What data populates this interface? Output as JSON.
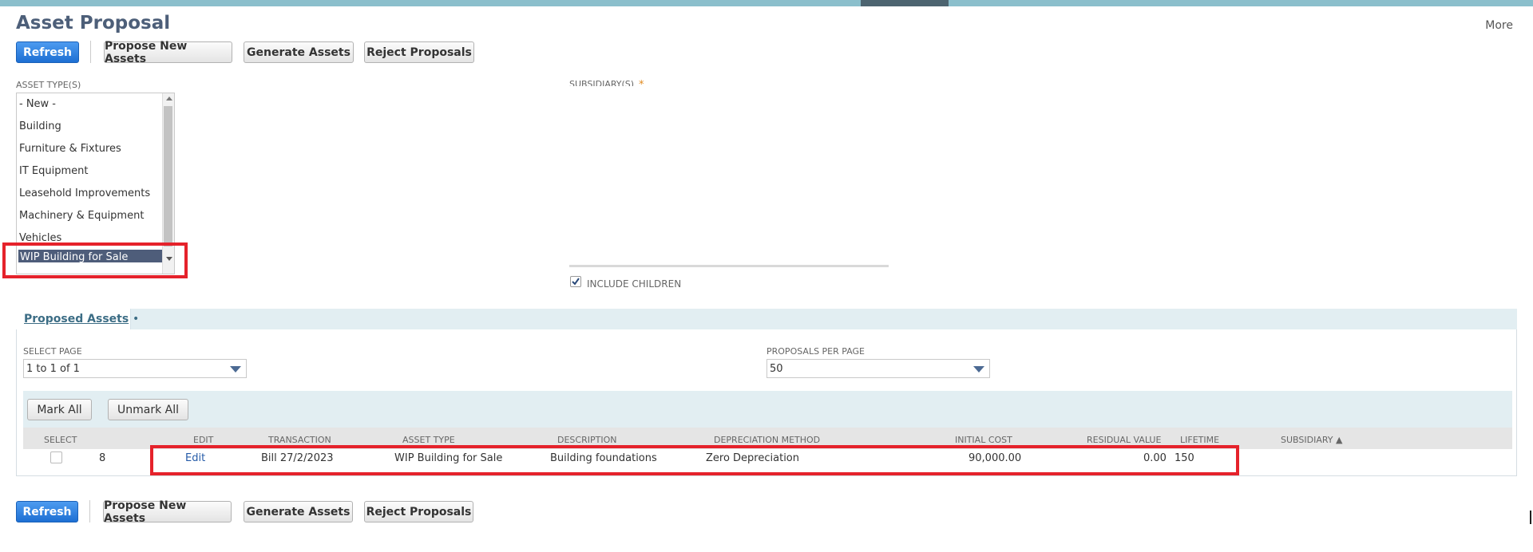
{
  "page": {
    "title": "Asset Proposal",
    "more": "More"
  },
  "toolbar": {
    "refresh": "Refresh",
    "propose_new_assets": "Propose New Assets",
    "generate_assets": "Generate Assets",
    "reject_proposals": "Reject Proposals"
  },
  "filters": {
    "asset_types_label": "ASSET TYPE(S)",
    "asset_types": [
      "- New -",
      "Building",
      "Furniture & Fixtures",
      "IT Equipment",
      "Leasehold Improvements",
      "Machinery & Equipment",
      "Vehicles",
      "WIP Building for Sale"
    ],
    "selected_asset_type": "WIP Building for Sale",
    "subsidiary_label": "SUBSIDIARY(S)",
    "required_mark": "*",
    "include_children_label": "INCLUDE CHILDREN",
    "include_children_checked": true
  },
  "tab": {
    "label": "Proposed Assets",
    "dot": "•"
  },
  "paging": {
    "select_page_label": "SELECT PAGE",
    "select_page_value": "1 to 1 of 1",
    "per_page_label": "PROPOSALS PER PAGE",
    "per_page_value": "50"
  },
  "mark": {
    "mark_all": "Mark All",
    "unmark_all": "Unmark All"
  },
  "table": {
    "headers": {
      "select": "SELECT",
      "edit": "EDIT",
      "transaction": "TRANSACTION",
      "asset_type": "ASSET TYPE",
      "description": "DESCRIPTION",
      "depreciation_method": "DEPRECIATION METHOD",
      "initial_cost": "INITIAL COST",
      "residual_value": "RESIDUAL VALUE",
      "lifetime": "LIFETIME",
      "subsidiary": "SUBSIDIARY ▲"
    },
    "rows": [
      {
        "number": "8",
        "edit": "Edit",
        "transaction": "Bill 27/2/2023",
        "asset_type": "WIP Building for Sale",
        "description": "Building foundations",
        "depreciation_method": "Zero Depreciation",
        "initial_cost": "90,000.00",
        "residual_value": "0.00",
        "lifetime": "150",
        "subsidiary": ""
      }
    ]
  },
  "colors": {
    "accent": "#1d6fd3",
    "highlight": "#e5222b",
    "selected": "#4e5d7a"
  }
}
